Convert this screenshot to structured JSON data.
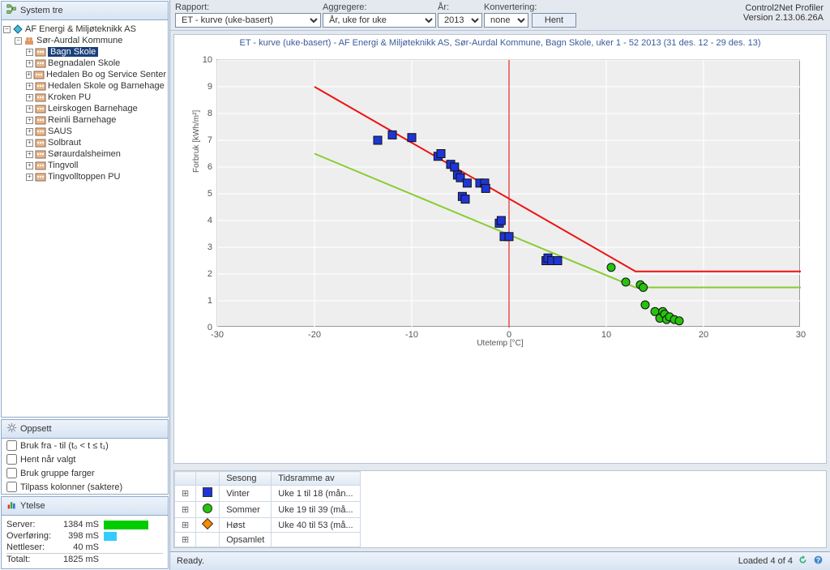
{
  "left": {
    "system_tree_title": "System tre",
    "root": "AF Energi & Miljøteknikk AS",
    "kommune": "Sør-Aurdal Kommune",
    "sites": [
      "Bagn Skole",
      "Begnadalen Skole",
      "Hedalen Bo og Service Senter",
      "Hedalen Skole og Barnehage",
      "Kroken PU",
      "Leirskogen Barnehage",
      "Reinli Barnehage",
      "SAUS",
      "Solbraut",
      "Søraurdalsheimen",
      "Tingvoll",
      "Tingvolltoppen PU"
    ],
    "selected_index": 0,
    "oppsett_title": "Oppsett",
    "oppsett_items": [
      "Bruk fra - til (t₀ < t ≤ t₁)",
      "Hent når valgt",
      "Bruk gruppe farger",
      "Tilpass kolonner (saktere)"
    ],
    "ytelse_title": "Ytelse",
    "ytelse": {
      "server_label": "Server:",
      "server": "1384 mS",
      "overforing_label": "Overføring:",
      "overforing": "398 mS",
      "nettleser_label": "Nettleser:",
      "nettleser": "40 mS",
      "totalt_label": "Totalt:",
      "totalt": "1825 mS"
    }
  },
  "top": {
    "rapport_label": "Rapport:",
    "rapport": "ET - kurve (uke-basert)",
    "aggregere_label": "Aggregere:",
    "aggregere": "År, uke for uke",
    "ar_label": "År:",
    "ar": "2013",
    "konvertering_label": "Konvertering:",
    "konvertering": "none",
    "hent": "Hent",
    "brand": "Control2Net Profiler",
    "version": "Version 2.13.06.26A"
  },
  "chart_data": {
    "type": "scatter",
    "title": "ET - kurve (uke-basert) - AF Energi & Miljøteknikk AS, Sør-Aurdal Kommune, Bagn Skole, uker 1 - 52 2013 (31 des. 12 - 29 des. 13)",
    "xlabel": "Utetemp [°C]",
    "ylabel": "Forbruk [kWh/m²]",
    "xlim": [
      -30,
      30
    ],
    "ylim": [
      0,
      10
    ],
    "x_ticks": [
      -30,
      -20,
      -10,
      0,
      10,
      20,
      30
    ],
    "y_ticks": [
      0,
      1,
      2,
      3,
      4,
      5,
      6,
      7,
      8,
      9,
      10
    ],
    "red_line": [
      [
        -20,
        9
      ],
      [
        13,
        2.1
      ],
      [
        30,
        2.1
      ]
    ],
    "green_line": [
      [
        -20,
        6.5
      ],
      [
        13,
        1.5
      ],
      [
        30,
        1.5
      ]
    ],
    "vline_x": 0,
    "series": [
      {
        "name": "Vinter",
        "shape": "square",
        "color": "#2035d6",
        "points": [
          [
            -13.5,
            7.0
          ],
          [
            -12.0,
            7.2
          ],
          [
            -10.0,
            7.1
          ],
          [
            -7.3,
            6.4
          ],
          [
            -7.0,
            6.5
          ],
          [
            -6.0,
            6.1
          ],
          [
            -5.6,
            6.0
          ],
          [
            -5.3,
            5.7
          ],
          [
            -5.0,
            5.6
          ],
          [
            -4.8,
            4.9
          ],
          [
            -4.5,
            4.8
          ],
          [
            -4.3,
            5.4
          ],
          [
            -3.0,
            5.4
          ],
          [
            -2.5,
            5.4
          ],
          [
            -2.4,
            5.2
          ],
          [
            -1.0,
            3.9
          ],
          [
            -0.8,
            4.0
          ],
          [
            -0.5,
            3.4
          ],
          [
            0.0,
            3.4
          ],
          [
            3.8,
            2.5
          ],
          [
            4.0,
            2.6
          ],
          [
            4.4,
            2.5
          ],
          [
            5.0,
            2.5
          ]
        ]
      },
      {
        "name": "Sommer",
        "shape": "circle",
        "color": "#25c40b",
        "points": [
          [
            10.5,
            2.25
          ],
          [
            12.0,
            1.7
          ],
          [
            13.5,
            1.6
          ],
          [
            13.8,
            1.5
          ],
          [
            14.0,
            0.85
          ],
          [
            15.0,
            0.6
          ],
          [
            15.5,
            0.35
          ],
          [
            15.8,
            0.6
          ],
          [
            16.0,
            0.5
          ],
          [
            16.2,
            0.3
          ],
          [
            16.5,
            0.4
          ],
          [
            17.0,
            0.3
          ],
          [
            17.5,
            0.25
          ]
        ]
      },
      {
        "name": "Høst",
        "shape": "diamond",
        "color": "#ff8a00",
        "points": []
      }
    ]
  },
  "seasons": {
    "col_sesong": "Sesong",
    "col_tid": "Tidsramme av",
    "rows": [
      {
        "name": "Vinter",
        "tid": "Uke 1 til 18 (mån...",
        "shape": "square",
        "color": "#2035d6"
      },
      {
        "name": "Sommer",
        "tid": "Uke 19 til 39 (må...",
        "shape": "circle",
        "color": "#25c40b"
      },
      {
        "name": "Høst",
        "tid": "Uke 40 til 53 (må...",
        "shape": "diamond",
        "color": "#ff8a00"
      },
      {
        "name": "Opsamlet",
        "tid": "",
        "shape": "",
        "color": ""
      }
    ]
  },
  "status": {
    "ready": "Ready.",
    "loaded": "Loaded 4 of 4"
  }
}
